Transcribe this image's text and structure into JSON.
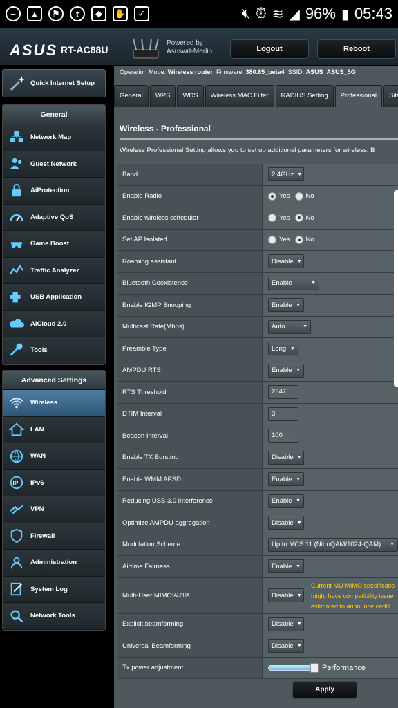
{
  "status_bar": {
    "battery": "96%",
    "time": "05:43",
    "icons": [
      "minus-circle-icon",
      "photos-icon",
      "flag-icon",
      "t-icon",
      "shield-icon",
      "hand-icon",
      "checklist-icon",
      "mute-icon",
      "alarm-icon",
      "wifi-icon",
      "signal-icon",
      "battery-icon"
    ]
  },
  "header": {
    "logo": "ASUS",
    "model": "RT-AC88U",
    "powered_line1": "Powered by",
    "powered_line2": "Asuswrt-Merlin",
    "logout": "Logout",
    "reboot": "Reboot"
  },
  "sidebar": {
    "quick_setup": "Quick Internet Setup",
    "general_title": "General",
    "general_items": [
      {
        "label": "Network Map",
        "icon": "network-map-icon"
      },
      {
        "label": "Guest Network",
        "icon": "guest-network-icon"
      },
      {
        "label": "AiProtection",
        "icon": "aiprotection-icon"
      },
      {
        "label": "Adaptive QoS",
        "icon": "adaptive-qos-icon"
      },
      {
        "label": "Game Boost",
        "icon": "game-boost-icon"
      },
      {
        "label": "Traffic Analyzer",
        "icon": "traffic-analyzer-icon"
      },
      {
        "label": "USB Application",
        "icon": "usb-application-icon"
      },
      {
        "label": "AiCloud 2.0",
        "icon": "aicloud-icon"
      },
      {
        "label": "Tools",
        "icon": "tools-icon"
      }
    ],
    "advanced_title": "Advanced Settings",
    "advanced_items": [
      {
        "label": "Wireless",
        "icon": "wireless-icon",
        "active": true
      },
      {
        "label": "LAN",
        "icon": "lan-icon"
      },
      {
        "label": "WAN",
        "icon": "wan-icon"
      },
      {
        "label": "IPv6",
        "icon": "ipv6-icon"
      },
      {
        "label": "VPN",
        "icon": "vpn-icon"
      },
      {
        "label": "Firewall",
        "icon": "firewall-icon"
      },
      {
        "label": "Administration",
        "icon": "administration-icon"
      },
      {
        "label": "System Log",
        "icon": "system-log-icon"
      },
      {
        "label": "Network Tools",
        "icon": "network-tools-icon"
      }
    ]
  },
  "infobar": {
    "op_mode_label": "Operation Mode:",
    "op_mode": "Wireless router",
    "firmware_label": "Firmware:",
    "firmware": "380.65_beta4",
    "ssid_label": "SSID:",
    "ssid1": "ASUS",
    "ssid2": "ASUS_5G"
  },
  "tabs": [
    "General",
    "WPS",
    "WDS",
    "Wireless MAC Filter",
    "RADIUS Setting",
    "Professional",
    "Site"
  ],
  "active_tab": "Professional",
  "page": {
    "title": "Wireless - Professional",
    "description": "Wireless Professional Setting allows you to set up additional parameters for wireless. B"
  },
  "settings": [
    {
      "label": "Band",
      "type": "select",
      "value": "2.4GHz"
    },
    {
      "label": "Enable Radio",
      "type": "radio",
      "yes": "Yes",
      "no": "No",
      "selected": "yes"
    },
    {
      "label": "Enable wireless scheduler",
      "type": "radio",
      "yes": "Yes",
      "no": "No",
      "selected": "no"
    },
    {
      "label": "Set AP Isolated",
      "type": "radio",
      "yes": "Yes",
      "no": "No",
      "selected": "no"
    },
    {
      "label": "Roaming assistant",
      "type": "select",
      "value": "Disable"
    },
    {
      "label": "Bluetooth Coexistence",
      "type": "select",
      "value": "Enable"
    },
    {
      "label": "Enable IGMP Snooping",
      "type": "select",
      "value": "Enable"
    },
    {
      "label": "Multicast Rate(Mbps)",
      "type": "select",
      "value": "Auto"
    },
    {
      "label": "Preamble Type",
      "type": "select",
      "value": "Long"
    },
    {
      "label": "AMPDU RTS",
      "type": "select",
      "value": "Enable"
    },
    {
      "label": "RTS Threshold",
      "type": "text",
      "value": "2347"
    },
    {
      "label": "DTIM Interval",
      "type": "text",
      "value": "3"
    },
    {
      "label": "Beacon Interval",
      "type": "text",
      "value": "100"
    },
    {
      "label": "Enable TX Bursting",
      "type": "select",
      "value": "Disable"
    },
    {
      "label": "Enable WMM APSD",
      "type": "select",
      "value": "Enable"
    },
    {
      "label": "Reducing USB 3.0 interference",
      "type": "select",
      "value": "Enable"
    },
    {
      "label": "Optimize AMPDU aggregation",
      "type": "select",
      "value": "Disable"
    },
    {
      "label": "Modulation Scheme",
      "type": "select",
      "value": "Up to MCS 11 (NitroQAM/1024-QAM)"
    },
    {
      "label": "Airtime Fairness",
      "type": "select",
      "value": "Enable"
    },
    {
      "label": "Multi-User MIMO",
      "sup": "*ALPHA",
      "type": "select",
      "value": "Disable",
      "note": [
        "Current MU-MIMO specificatio",
        "might have compatibility issue",
        "estimated to announce certifi"
      ]
    },
    {
      "label": "Explicit beamforming",
      "type": "select",
      "value": "Disable"
    },
    {
      "label": "Universal Beamforming",
      "type": "select",
      "value": "Disable"
    },
    {
      "label": "Tx power adjustment",
      "type": "slider",
      "value": "Performance",
      "level": 1.0
    }
  ],
  "apply": "Apply"
}
